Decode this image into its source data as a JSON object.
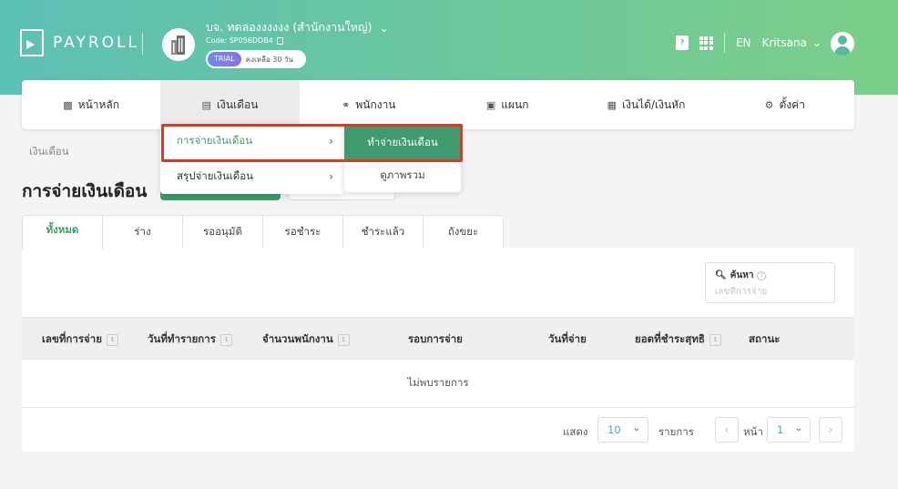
{
  "header": {
    "app_name": "PAYROLL",
    "company_name": "บจ. ทดลองงงงงง (สำนักงานใหญ่)",
    "company_code": "Code: SP056DDB4",
    "trial_badge": "TRIAL",
    "trial_remaining": "คงเหลือ 30 วัน",
    "language": "EN",
    "username": "Kritsana"
  },
  "nav": {
    "items": [
      {
        "label": "หน้าหลัก",
        "icon": "chart-icon"
      },
      {
        "label": "เงินเดือน",
        "icon": "payroll-icon"
      },
      {
        "label": "พนักงาน",
        "icon": "people-icon"
      },
      {
        "label": "แผนก",
        "icon": "department-icon"
      },
      {
        "label": "เงินได้/เงินหัก",
        "icon": "income-deduction-icon"
      },
      {
        "label": "ตั้งค่า",
        "icon": "gears-icon"
      }
    ]
  },
  "breadcrumb": "เงินเดือน",
  "page_title": "การจ่ายเงินเดือน",
  "dropdown": {
    "level1": [
      {
        "label": "การจ่ายเงินเดือน"
      },
      {
        "label": "สรุปจ่ายเงินเดือน"
      }
    ],
    "level2": [
      {
        "label": "ทำจ่ายเงินเดือน"
      },
      {
        "label": "ดูภาพรวม"
      }
    ]
  },
  "tabs": [
    "ทั้งหมด",
    "ร่าง",
    "รออนุมัติ",
    "รอชำระ",
    "ชำระแล้ว",
    "ถังขยะ"
  ],
  "search": {
    "label": "ค้นหา",
    "placeholder": "เลขที่การจ่าย"
  },
  "table": {
    "columns": [
      "เลขที่การจ่าย",
      "วันที่ทำรายการ",
      "จำนวนพนักงาน",
      "รอบการจ่าย",
      "วันที่จ่าย",
      "ยอดที่ชำระสุทธิ",
      "สถานะ"
    ],
    "empty_text": "ไม่พบรายการ"
  },
  "pagination": {
    "show_label": "แสดง",
    "page_size": "10",
    "items_label": "รายการ",
    "page_label": "หน้า",
    "current_page": "1"
  },
  "colors": {
    "accent_green": "#3f9b6d",
    "highlight_red": "#d83a2a"
  }
}
